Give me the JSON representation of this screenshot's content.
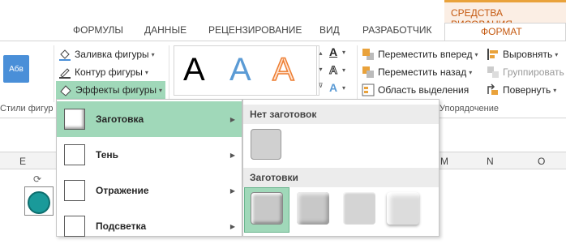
{
  "tabs": [
    "ФОРМУЛЫ",
    "ДАННЫЕ",
    "РЕЦЕНЗИРОВАНИЕ",
    "ВИД",
    "РАЗРАБОТЧИК"
  ],
  "context_tab": {
    "header": "СРЕДСТВА РИСОВАНИЯ",
    "tab": "ФОРМАТ"
  },
  "ribbon": {
    "style_sample": "Абв",
    "fill": "Заливка фигуры",
    "outline": "Контур фигуры",
    "effects": "Эффекты фигуры",
    "group_styles": "Стили фигур",
    "wordart": [
      "A",
      "A",
      "A"
    ],
    "text_icons": [
      "A",
      "A",
      "A"
    ],
    "forward": "Переместить вперед",
    "backward": "Переместить назад",
    "selection": "Область выделения",
    "align": "Выровнять",
    "group": "Группировать",
    "rotate": "Повернуть",
    "group_arrange": "Упорядочение"
  },
  "columns": [
    "E",
    "M",
    "N",
    "O"
  ],
  "menu": {
    "items": [
      {
        "label": "Заготовка",
        "active": true
      },
      {
        "label": "Тень",
        "active": false
      },
      {
        "label": "Отражение",
        "active": false
      },
      {
        "label": "Подсветка",
        "active": false
      }
    ]
  },
  "gallery": {
    "none_header": "Нет заготовок",
    "presets_header": "Заготовки"
  },
  "colors": {
    "accent": "#c55a11",
    "active_menu": "#a0d8b9",
    "shape": "#1a9a9a"
  }
}
